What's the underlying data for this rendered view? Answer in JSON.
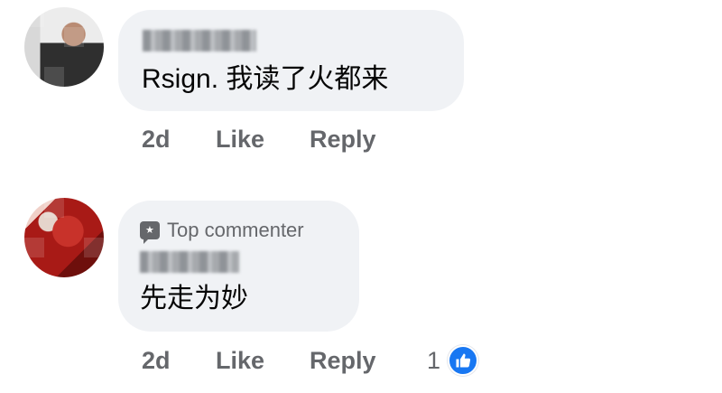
{
  "comments": [
    {
      "text": "Rsign. 我读了火都来",
      "time": "2d",
      "like_label": "Like",
      "reply_label": "Reply"
    },
    {
      "badge": "Top commenter",
      "badge_icon": "top-commenter-icon",
      "text": "先走为妙",
      "time": "2d",
      "like_label": "Like",
      "reply_label": "Reply",
      "reaction_count": "1",
      "reaction_icon": "like-reaction-icon"
    }
  ],
  "colors": {
    "bubble": "#f0f2f5",
    "secondary_text": "#65676b",
    "like_blue": "#1877f2"
  }
}
